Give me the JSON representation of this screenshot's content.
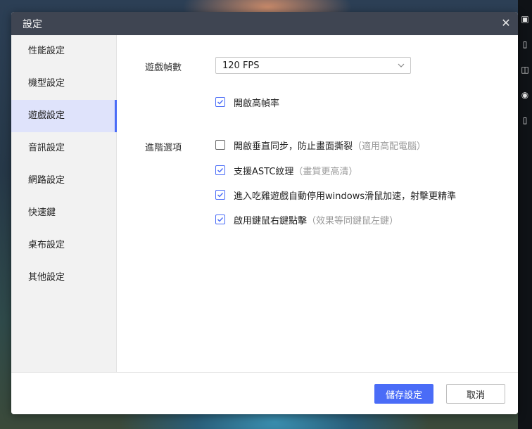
{
  "dialog": {
    "title": "設定",
    "close_glyph": "✕"
  },
  "sidebar": {
    "items": [
      {
        "label": "性能設定"
      },
      {
        "label": "機型設定"
      },
      {
        "label": "遊戲設定"
      },
      {
        "label": "音訊設定"
      },
      {
        "label": "網路設定"
      },
      {
        "label": "快速鍵"
      },
      {
        "label": "桌布設定"
      },
      {
        "label": "其他設定"
      }
    ],
    "active_index": 2
  },
  "game": {
    "fps_label": "遊戲幀數",
    "fps_value": "120 FPS",
    "high_fps": {
      "label": "開啟高幀率",
      "checked": true
    },
    "advanced_label": "進階選項",
    "options": [
      {
        "label": "開啟垂直同步，防止畫面撕裂",
        "hint": "（適用高配電腦）",
        "checked": false
      },
      {
        "label": "支援ASTC紋理",
        "hint": "（畫質更高清）",
        "checked": true
      },
      {
        "label": "進入吃雞遊戲自動停用windows滑鼠加速，射擊更精準",
        "hint": "",
        "checked": true
      },
      {
        "label": "啟用鍵鼠右鍵點擊",
        "hint": "（效果等同鍵鼠左鍵）",
        "checked": true
      }
    ]
  },
  "footer": {
    "save_label": "儲存設定",
    "cancel_label": "取消"
  },
  "colors": {
    "accent": "#4a6cf7",
    "titlebar": "#3f4552",
    "sidebar_bg": "#f2f2f2",
    "active_bg": "#dfe3fb"
  }
}
